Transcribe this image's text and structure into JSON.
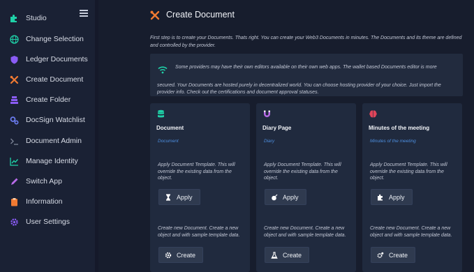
{
  "sidebar": {
    "items": [
      {
        "label": "Studio",
        "icon": "puzzle-icon"
      },
      {
        "label": "Change Selection",
        "icon": "globe-icon"
      },
      {
        "label": "Ledger Documents",
        "icon": "shield-icon"
      },
      {
        "label": "Create Document",
        "icon": "tools-icon"
      },
      {
        "label": "Create Folder",
        "icon": "archive-icon"
      },
      {
        "label": "DocSign Watchlist",
        "icon": "cogs-icon"
      },
      {
        "label": "Document Admin",
        "icon": "terminal-icon"
      },
      {
        "label": "Manage Identity",
        "icon": "chart-line-icon"
      },
      {
        "label": "Switch App",
        "icon": "pen-icon"
      },
      {
        "label": "Information",
        "icon": "clipboard-icon"
      },
      {
        "label": "User Settings",
        "icon": "gear-icon"
      }
    ]
  },
  "header": {
    "title": "Create Document"
  },
  "intro": "First step is to create your Documents. Thats right. You can create your Web3 Documents in minutes. The Documents and its theme are defined and controlled by the provider.",
  "notice": {
    "line1": "Some providers may have their own editors available on their own web apps. The wallet based Documents editor is more",
    "line2": "secured. Your Documents are hosted purely in decentralized world. You can choose hosting provider of your choice. Just import the provider info. Check out the certifications and document approval statuses."
  },
  "cards": [
    {
      "title": "Document",
      "subtitle": "Document",
      "apply_desc": "Apply Document Template. This will override the existing data from the object.",
      "apply_label": "Apply",
      "create_desc": "Create new Document. Create a new object and with sample template data.",
      "create_label": "Create"
    },
    {
      "title": "Diary Page",
      "subtitle": "Diary",
      "apply_desc": "Apply Document Template. This will override the existing data from the object.",
      "apply_label": "Apply",
      "create_desc": "Create new Document. Create a new object and with sample template data.",
      "create_label": "Create"
    },
    {
      "title": "Minutes of the meeting",
      "subtitle": "Minutes of the meeting",
      "apply_desc": "Apply Document Template. This will override the existing data from the object.",
      "apply_label": "Apply",
      "create_desc": "Create new Document. Create a new object and with sample template data.",
      "create_label": "Create"
    }
  ],
  "colors": {
    "accent_teal": "#1fd1a8",
    "accent_orange": "#f07a32",
    "accent_purple": "#8a5cf5",
    "accent_red": "#e0455a",
    "link_blue": "#4d8fe0"
  }
}
